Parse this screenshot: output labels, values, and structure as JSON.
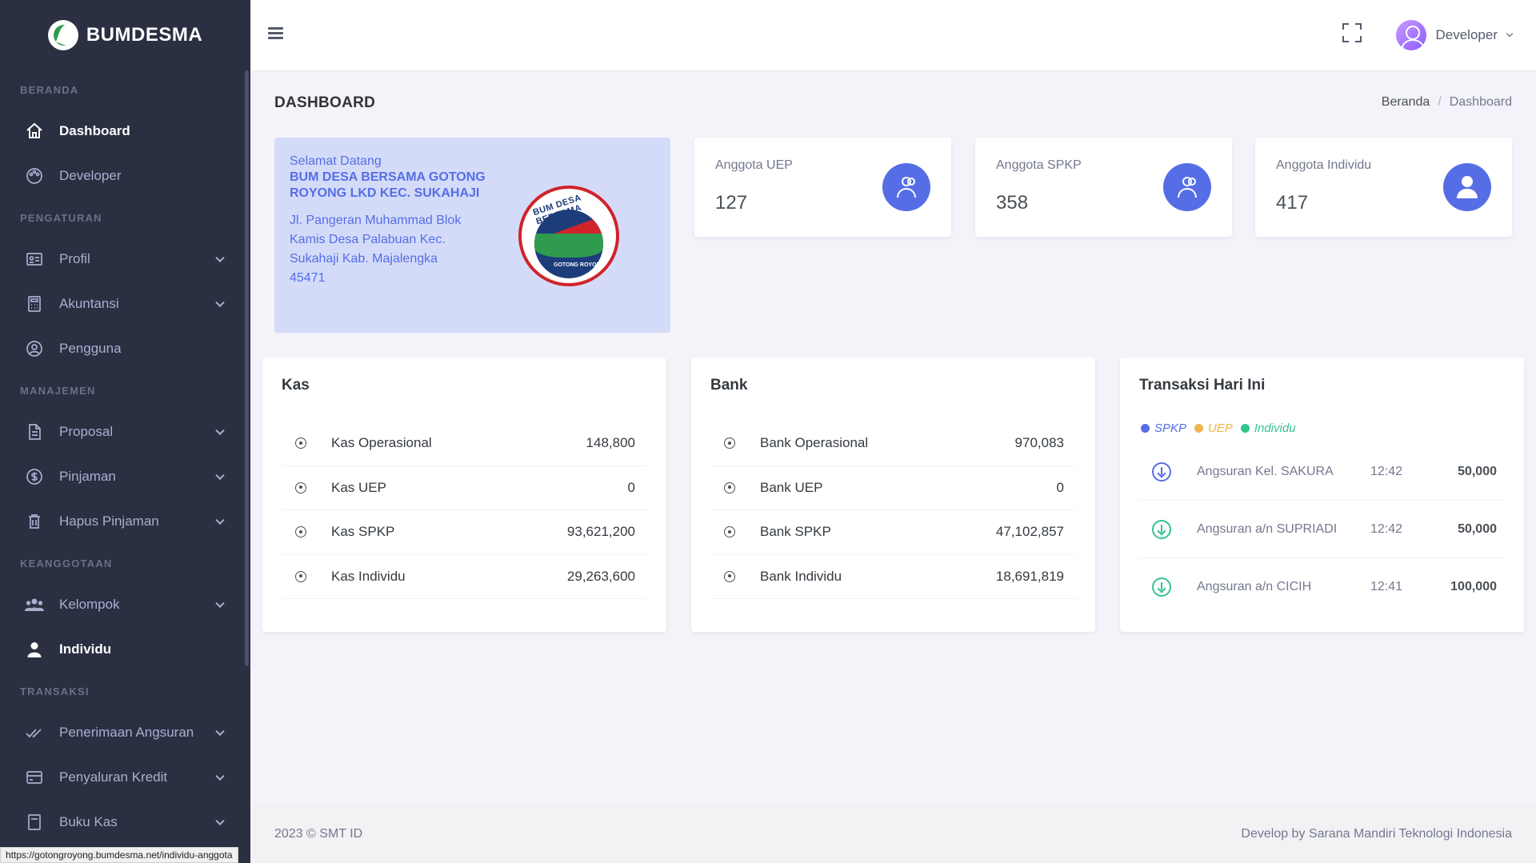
{
  "brand": {
    "name": "BUMDESMA"
  },
  "sidebar": {
    "sections": [
      {
        "title": "BERANDA",
        "items": [
          {
            "label": "Dashboard",
            "icon": "home-icon",
            "active": true,
            "chevron": false
          },
          {
            "label": "Developer",
            "icon": "palette-icon",
            "active": false,
            "chevron": false
          }
        ]
      },
      {
        "title": "PENGATURAN",
        "items": [
          {
            "label": "Profil",
            "icon": "id-card-icon",
            "chevron": true
          },
          {
            "label": "Akuntansi",
            "icon": "calculator-icon",
            "chevron": true
          },
          {
            "label": "Pengguna",
            "icon": "user-circle-icon",
            "chevron": false
          }
        ]
      },
      {
        "title": "MANAJEMEN",
        "items": [
          {
            "label": "Proposal",
            "icon": "document-icon",
            "chevron": true
          },
          {
            "label": "Pinjaman",
            "icon": "dollar-circle-icon",
            "chevron": true
          },
          {
            "label": "Hapus Pinjaman",
            "icon": "trash-icon",
            "chevron": true
          }
        ]
      },
      {
        "title": "KEANGGOTAAN",
        "items": [
          {
            "label": "Kelompok",
            "icon": "users-icon",
            "chevron": true
          },
          {
            "label": "Individu",
            "icon": "user-icon",
            "active": true,
            "chevron": false
          }
        ]
      },
      {
        "title": "TRANSAKSI",
        "items": [
          {
            "label": "Penerimaan Angsuran",
            "icon": "check-double-icon",
            "chevron": true
          },
          {
            "label": "Penyaluran Kredit",
            "icon": "credit-card-icon",
            "chevron": true
          },
          {
            "label": "Buku Kas",
            "icon": "book-icon",
            "chevron": true
          }
        ]
      }
    ]
  },
  "statusbar": {
    "url": "https://gotongroyong.bumdesma.net/individu-anggota"
  },
  "topbar": {
    "user_name": "Developer"
  },
  "page": {
    "title": "DASHBOARD",
    "breadcrumb": {
      "home": "Beranda",
      "current": "Dashboard"
    }
  },
  "welcome": {
    "greeting": "Selamat Datang",
    "org": "BUM DESA BERSAMA GOTONG ROYONG LKD KEC. SUKAHAJI",
    "address": "Jl. Pangeran Muhammad Blok Kamis Desa Palabuan Kec. Sukahaji Kab. Majalengka 45471",
    "seal_top": "BUM DESA BERSAMA",
    "seal_bottom": "GOTONG ROYONG"
  },
  "stats": [
    {
      "label": "Anggota UEP",
      "value": "127",
      "icon": "users-icon"
    },
    {
      "label": "Anggota SPKP",
      "value": "358",
      "icon": "users-icon"
    },
    {
      "label": "Anggota Individu",
      "value": "417",
      "icon": "user-icon"
    }
  ],
  "kas": {
    "title": "Kas",
    "rows": [
      {
        "name": "Kas Operasional",
        "amount": "148,800"
      },
      {
        "name": "Kas UEP",
        "amount": "0"
      },
      {
        "name": "Kas SPKP",
        "amount": "93,621,200"
      },
      {
        "name": "Kas Individu",
        "amount": "29,263,600"
      }
    ]
  },
  "bank": {
    "title": "Bank",
    "rows": [
      {
        "name": "Bank Operasional",
        "amount": "970,083"
      },
      {
        "name": "Bank UEP",
        "amount": "0"
      },
      {
        "name": "Bank SPKP",
        "amount": "47,102,857"
      },
      {
        "name": "Bank Individu",
        "amount": "18,691,819"
      }
    ]
  },
  "transaksi": {
    "title": "Transaksi Hari Ini",
    "legend": [
      {
        "label": "SPKP",
        "color": "#556ee6"
      },
      {
        "label": "UEP",
        "color": "#f1b44c"
      },
      {
        "label": "Individu",
        "color": "#34c38f"
      }
    ],
    "rows": [
      {
        "desc": "Angsuran Kel. SAKURA",
        "time": "12:42",
        "amount": "50,000",
        "type": "blue"
      },
      {
        "desc": "Angsuran a/n SUPRIADI",
        "time": "12:42",
        "amount": "50,000",
        "type": "green"
      },
      {
        "desc": "Angsuran a/n CICIH",
        "time": "12:41",
        "amount": "100,000",
        "type": "green"
      }
    ]
  },
  "footer": {
    "left": "2023 © SMT ID",
    "right": "Develop by Sarana Mandiri Teknologi Indonesia"
  },
  "colors": {
    "sidebar_bg": "#2a3042",
    "primary": "#556ee6",
    "welcome_bg": "#d4dbf9",
    "success": "#34c38f",
    "warning": "#f1b44c"
  }
}
